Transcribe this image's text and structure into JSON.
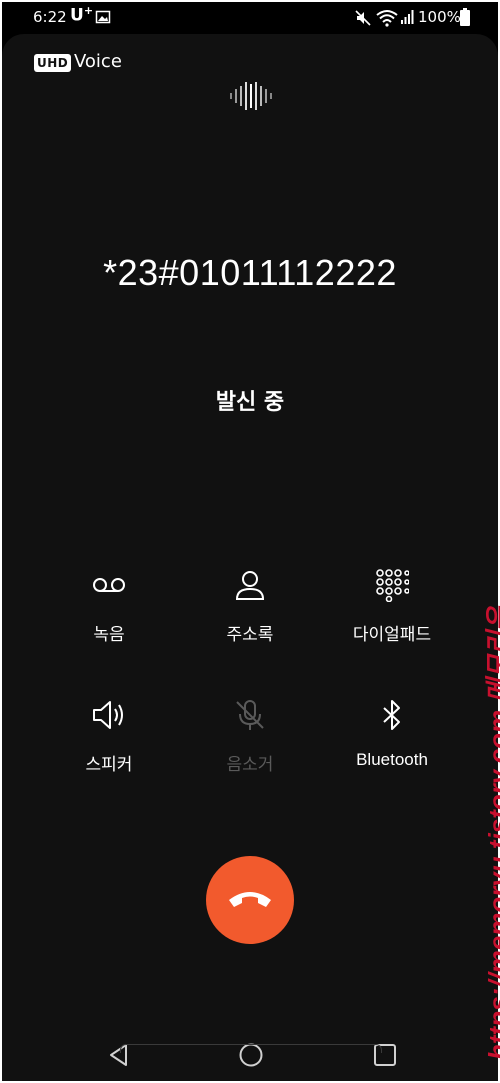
{
  "status_bar": {
    "time": "6:22",
    "carrier": "U",
    "carrier_sup": "+",
    "battery_percent": "100%",
    "icons": [
      "image-icon",
      "mute-icon",
      "wifi-icon",
      "signal-icon",
      "battery-icon"
    ]
  },
  "call": {
    "hd_badge": "UHD",
    "hd_label": "Voice",
    "number": "*23#01011112222",
    "status": "발신 중"
  },
  "controls": [
    {
      "label": "녹음",
      "icon": "voicemail-record-icon",
      "enabled": true
    },
    {
      "label": "주소록",
      "icon": "contacts-icon",
      "enabled": true
    },
    {
      "label": "다이얼패드",
      "icon": "dialpad-icon",
      "enabled": true
    },
    {
      "label": "스피커",
      "icon": "speaker-icon",
      "enabled": true
    },
    {
      "label": "음소거",
      "icon": "mute-mic-icon",
      "enabled": false
    },
    {
      "label": "Bluetooth",
      "icon": "bluetooth-icon",
      "enabled": true
    }
  ],
  "end_call": {
    "icon": "end-call-icon",
    "color": "#f25a2d"
  },
  "nav": [
    "back-icon",
    "home-icon",
    "recents-icon"
  ],
  "watermark": "https://memoryu.tistory.com 메모리유",
  "colors": {
    "background": "#111111",
    "accent": "#f25a2d",
    "disabled": "#5a5a5a"
  }
}
